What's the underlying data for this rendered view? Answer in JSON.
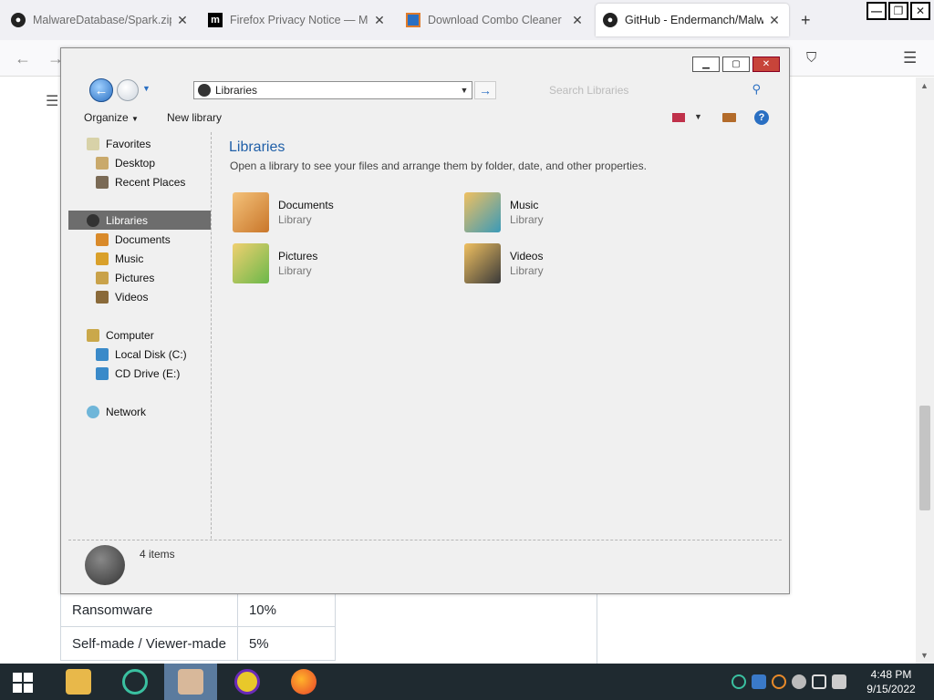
{
  "browser": {
    "tabs": [
      {
        "label": "MalwareDatabase/Spark.zip at",
        "icon": "github-icon"
      },
      {
        "label": "Firefox Privacy Notice — Moz",
        "icon": "mozilla-icon"
      },
      {
        "label": "Download Combo Cleaner",
        "icon": "combo-cleaner-icon"
      },
      {
        "label": "GitHub - Endermanch/Malwar",
        "icon": "github-icon",
        "active": true
      }
    ]
  },
  "page_table": {
    "rows": [
      {
        "category": "Ransomware",
        "value": "10%"
      },
      {
        "category": "Self-made / Viewer-made",
        "value": "5%"
      }
    ]
  },
  "explorer": {
    "address": "Libraries",
    "search_placeholder": "Search Libraries",
    "toolbar": {
      "organize": "Organize",
      "new_library": "New library"
    },
    "nav": {
      "favorites": "Favorites",
      "desktop": "Desktop",
      "recent_places": "Recent Places",
      "libraries": "Libraries",
      "documents": "Documents",
      "music": "Music",
      "pictures": "Pictures",
      "videos": "Videos",
      "computer": "Computer",
      "local_disk": "Local Disk (C:)",
      "cd_drive": "CD Drive (E:)",
      "network": "Network"
    },
    "content": {
      "title": "Libraries",
      "description": "Open a library to see your files and arrange them by folder, date, and other properties.",
      "items": [
        {
          "name": "Documents",
          "type": "Library"
        },
        {
          "name": "Music",
          "type": "Library"
        },
        {
          "name": "Pictures",
          "type": "Library"
        },
        {
          "name": "Videos",
          "type": "Library"
        }
      ]
    },
    "status": "4 items"
  },
  "taskbar": {
    "time": "4:48 PM",
    "date": "9/15/2022"
  },
  "colors": {
    "accent_blue": "#1f5fa8",
    "selection_gray": "#6d6d6d",
    "taskbar_bg": "#1f2a30",
    "close_red": "#c7443a"
  }
}
